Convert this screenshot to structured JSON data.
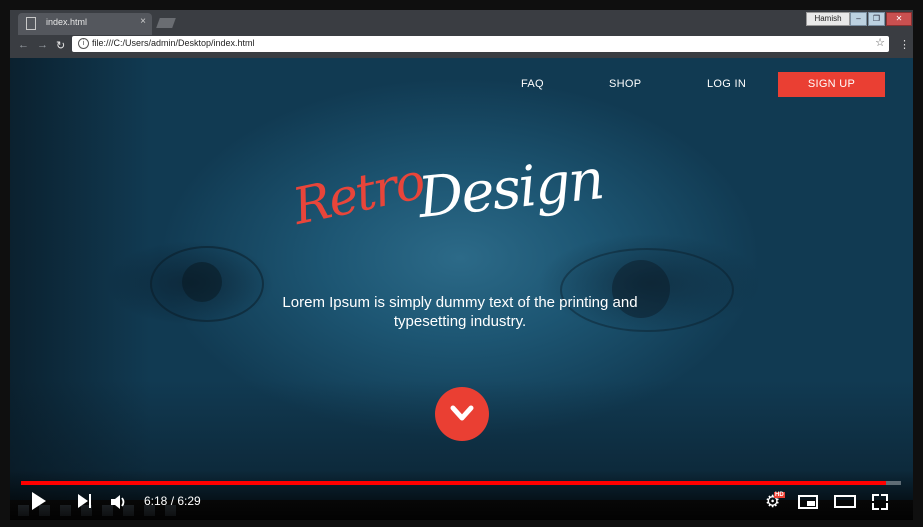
{
  "browser": {
    "tab_title": "index.html",
    "tab_close": "×",
    "profile_name": "Hamish",
    "url": "file:///C:/Users/admin/Desktop/index.html"
  },
  "site": {
    "nav": {
      "faq": "FAQ",
      "shop": "SHOP",
      "login": "LOG IN",
      "signup": "SIGN UP"
    },
    "logo": {
      "part1": "Retro",
      "part2": "Design"
    },
    "tagline": "Lorem Ipsum is simply dummy text of the printing and typesetting industry.",
    "accent_color": "#ea3f33"
  },
  "player": {
    "time": "6:18 / 6:29",
    "progress": 0.983,
    "quality_badge": "HD"
  }
}
